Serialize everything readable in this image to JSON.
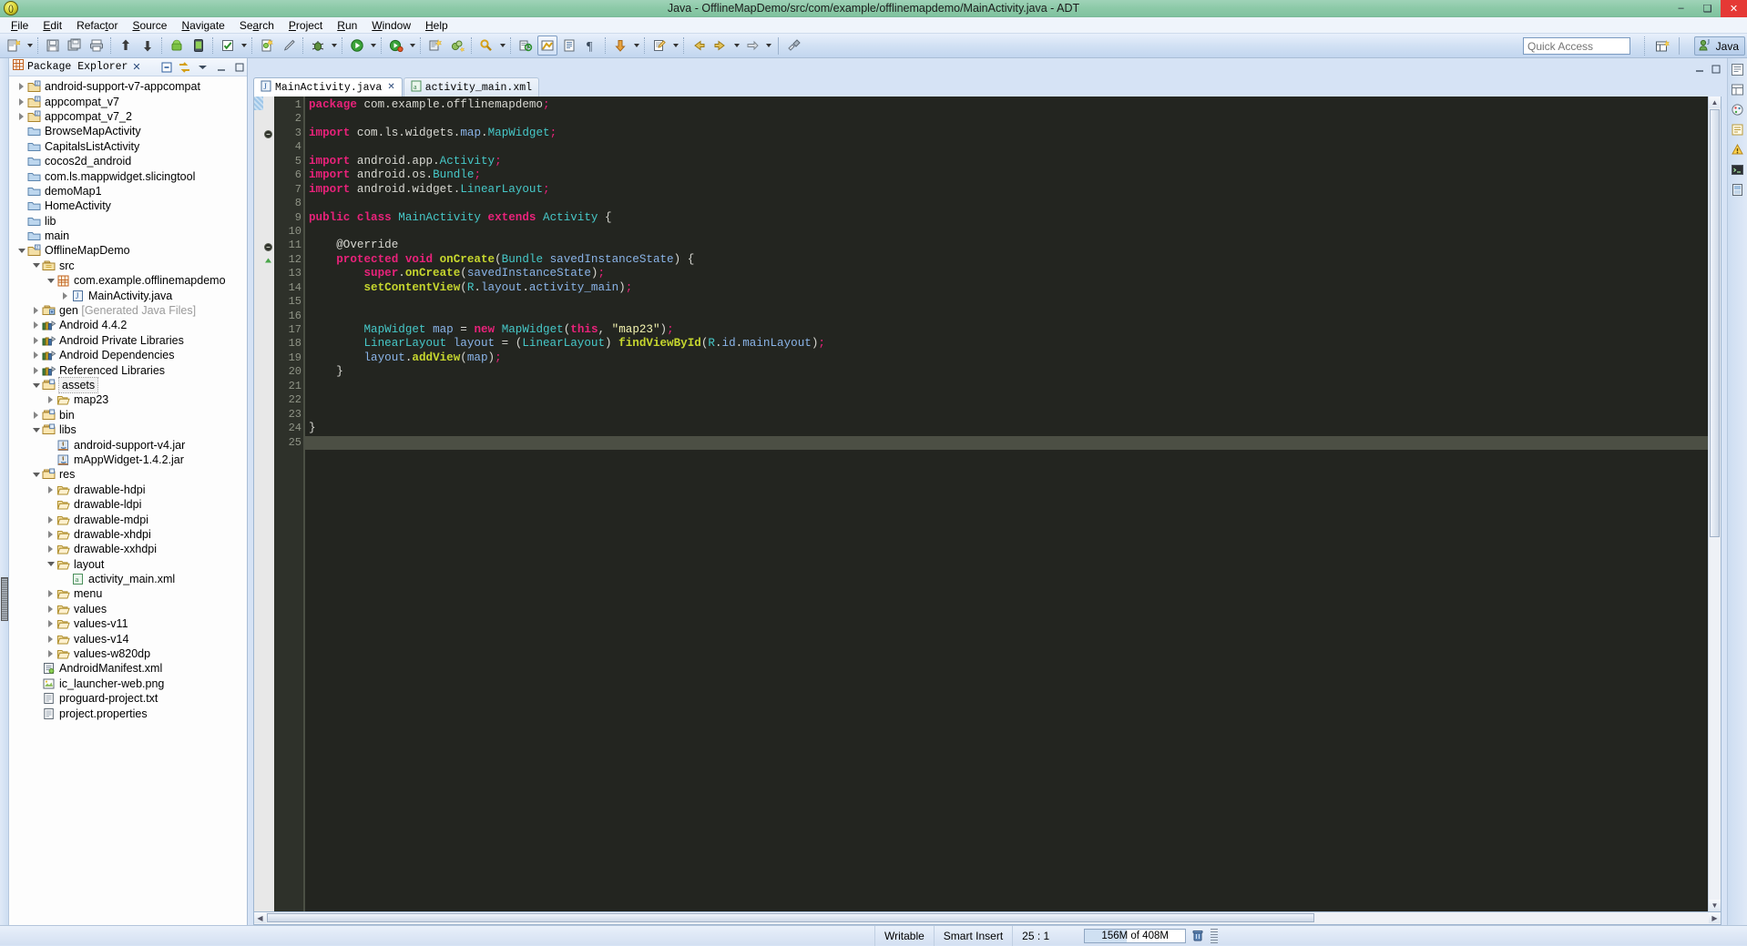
{
  "window": {
    "title": "Java - OfflineMapDemo/src/com/example/offlinemapdemo/MainActivity.java - ADT",
    "app_icon": "eclipse-icon",
    "minimize_label": "–",
    "maximize_label": "❑",
    "close_label": "✕"
  },
  "menubar": {
    "items": [
      {
        "label": "File",
        "mnemonic": "F"
      },
      {
        "label": "Edit",
        "mnemonic": "E"
      },
      {
        "label": "Refactor",
        "mnemonic": "t"
      },
      {
        "label": "Source",
        "mnemonic": "S"
      },
      {
        "label": "Navigate",
        "mnemonic": "N"
      },
      {
        "label": "Search",
        "mnemonic": "a"
      },
      {
        "label": "Project",
        "mnemonic": "P"
      },
      {
        "label": "Run",
        "mnemonic": "R"
      },
      {
        "label": "Window",
        "mnemonic": "W"
      },
      {
        "label": "Help",
        "mnemonic": "H"
      }
    ]
  },
  "toolbar": {
    "icons": [
      "new-wizard-icon",
      "save-icon",
      "save-all-icon",
      "print-icon",
      "export-icon",
      "import-icon",
      "android-sdk-manager-icon",
      "android-avd-manager-icon",
      "build-all-icon",
      "lint-icon",
      "new-android-xml-icon",
      "debug-icon",
      "run-icon",
      "external-tools-icon",
      "new-java-project-icon",
      "new-package-icon",
      "search-icon",
      "open-type-icon",
      "next-annotation-icon",
      "previous-annotation-icon",
      "last-edit-location-icon",
      "back-icon",
      "forward-icon",
      "pin-editor-icon"
    ],
    "quick_access_placeholder": "Quick Access",
    "open_perspective_icon": "open-perspective-icon",
    "perspective_label": "Java",
    "perspective_icon": "java-perspective-icon"
  },
  "explorer": {
    "title": "Package Explorer",
    "close_label": "✕",
    "buttons": [
      "collapse-all-icon",
      "link-with-editor-icon",
      "view-menu-icon",
      "minimize-icon",
      "maximize-icon"
    ],
    "tree": [
      {
        "label": "android-support-v7-appcompat",
        "indent": 0,
        "twist": "closed",
        "icon": "java-project-icon"
      },
      {
        "label": "appcompat_v7",
        "indent": 0,
        "twist": "closed",
        "icon": "java-project-icon"
      },
      {
        "label": "appcompat_v7_2",
        "indent": 0,
        "twist": "closed",
        "icon": "java-project-icon"
      },
      {
        "label": "BrowseMapActivity",
        "indent": 0,
        "twist": "none",
        "icon": "folder-closed-icon"
      },
      {
        "label": "CapitalsListActivity",
        "indent": 0,
        "twist": "none",
        "icon": "folder-closed-icon"
      },
      {
        "label": "cocos2d_android",
        "indent": 0,
        "twist": "none",
        "icon": "folder-closed-icon"
      },
      {
        "label": "com.ls.mappwidget.slicingtool",
        "indent": 0,
        "twist": "none",
        "icon": "folder-closed-icon"
      },
      {
        "label": "demoMap1",
        "indent": 0,
        "twist": "none",
        "icon": "folder-closed-icon"
      },
      {
        "label": "HomeActivity",
        "indent": 0,
        "twist": "none",
        "icon": "folder-closed-icon"
      },
      {
        "label": "lib",
        "indent": 0,
        "twist": "none",
        "icon": "folder-closed-icon"
      },
      {
        "label": "main",
        "indent": 0,
        "twist": "none",
        "icon": "folder-closed-icon"
      },
      {
        "label": "OfflineMapDemo",
        "indent": 0,
        "twist": "open",
        "icon": "java-project-icon"
      },
      {
        "label": "src",
        "indent": 1,
        "twist": "open",
        "icon": "source-folder-icon"
      },
      {
        "label": "com.example.offlinemapdemo",
        "indent": 2,
        "twist": "open",
        "icon": "package-icon"
      },
      {
        "label": "MainActivity.java",
        "indent": 3,
        "twist": "closed",
        "icon": "java-file-icon"
      },
      {
        "label": "gen ",
        "suffix": "[Generated Java Files]",
        "indent": 1,
        "twist": "closed",
        "icon": "gen-folder-icon"
      },
      {
        "label": "Android 4.4.2",
        "indent": 1,
        "twist": "closed",
        "icon": "library-icon"
      },
      {
        "label": "Android Private Libraries",
        "indent": 1,
        "twist": "closed",
        "icon": "library-icon"
      },
      {
        "label": "Android Dependencies",
        "indent": 1,
        "twist": "closed",
        "icon": "library-icon"
      },
      {
        "label": "Referenced Libraries",
        "indent": 1,
        "twist": "closed",
        "icon": "library-icon"
      },
      {
        "label": "assets",
        "indent": 1,
        "twist": "open",
        "icon": "res-folder-icon",
        "selected": true
      },
      {
        "label": "map23",
        "indent": 2,
        "twist": "closed",
        "icon": "folder-open-icon"
      },
      {
        "label": "bin",
        "indent": 1,
        "twist": "closed",
        "icon": "res-folder-icon"
      },
      {
        "label": "libs",
        "indent": 1,
        "twist": "open",
        "icon": "res-folder-icon"
      },
      {
        "label": "android-support-v4.jar",
        "indent": 2,
        "twist": "none",
        "icon": "jar-icon"
      },
      {
        "label": "mAppWidget-1.4.2.jar",
        "indent": 2,
        "twist": "none",
        "icon": "jar-icon"
      },
      {
        "label": "res",
        "indent": 1,
        "twist": "open",
        "icon": "res-folder-icon"
      },
      {
        "label": "drawable-hdpi",
        "indent": 2,
        "twist": "closed",
        "icon": "folder-open-icon"
      },
      {
        "label": "drawable-ldpi",
        "indent": 2,
        "twist": "none",
        "icon": "folder-open-icon"
      },
      {
        "label": "drawable-mdpi",
        "indent": 2,
        "twist": "closed",
        "icon": "folder-open-icon"
      },
      {
        "label": "drawable-xhdpi",
        "indent": 2,
        "twist": "closed",
        "icon": "folder-open-icon"
      },
      {
        "label": "drawable-xxhdpi",
        "indent": 2,
        "twist": "closed",
        "icon": "folder-open-icon"
      },
      {
        "label": "layout",
        "indent": 2,
        "twist": "open",
        "icon": "folder-open-icon"
      },
      {
        "label": "activity_main.xml",
        "indent": 3,
        "twist": "none",
        "icon": "xml-file-icon"
      },
      {
        "label": "menu",
        "indent": 2,
        "twist": "closed",
        "icon": "folder-open-icon"
      },
      {
        "label": "values",
        "indent": 2,
        "twist": "closed",
        "icon": "folder-open-icon"
      },
      {
        "label": "values-v11",
        "indent": 2,
        "twist": "closed",
        "icon": "folder-open-icon"
      },
      {
        "label": "values-v14",
        "indent": 2,
        "twist": "closed",
        "icon": "folder-open-icon"
      },
      {
        "label": "values-w820dp",
        "indent": 2,
        "twist": "closed",
        "icon": "folder-open-icon"
      },
      {
        "label": "AndroidManifest.xml",
        "indent": 1,
        "twist": "none",
        "icon": "manifest-icon"
      },
      {
        "label": "ic_launcher-web.png",
        "indent": 1,
        "twist": "none",
        "icon": "image-file-icon"
      },
      {
        "label": "proguard-project.txt",
        "indent": 1,
        "twist": "none",
        "icon": "text-file-icon"
      },
      {
        "label": "project.properties",
        "indent": 1,
        "twist": "none",
        "icon": "text-file-icon"
      }
    ]
  },
  "editor": {
    "tabs": [
      {
        "label": "MainActivity.java",
        "icon": "java-file-icon",
        "active": true,
        "close": "✕"
      },
      {
        "label": "activity_main.xml",
        "icon": "xml-file-icon",
        "active": false,
        "close": ""
      }
    ],
    "line_numbers": [
      "1",
      "2",
      "3",
      "4",
      "5",
      "6",
      "7",
      "8",
      "9",
      "10",
      "11",
      "12",
      "13",
      "14",
      "15",
      "16",
      "17",
      "18",
      "19",
      "20",
      "21",
      "22",
      "23",
      "24",
      "25"
    ],
    "code_lines": [
      "package com.example.offlinemapdemo;",
      "",
      "import com.ls.widgets.map.MapWidget;",
      "",
      "import android.app.Activity;",
      "import android.os.Bundle;",
      "import android.widget.LinearLayout;",
      "",
      "public class MainActivity extends Activity {",
      "",
      "    @Override",
      "    protected void onCreate(Bundle savedInstanceState) {",
      "        super.onCreate(savedInstanceState);",
      "        setContentView(R.layout.activity_main);",
      "",
      "",
      "        MapWidget map = new MapWidget(this, \"map23\");",
      "        LinearLayout layout = (LinearLayout) findViewById(R.id.mainLayout);",
      "        layout.addView(map);",
      "    }",
      "",
      "",
      "",
      "}",
      ""
    ],
    "cursor_line": 25,
    "fold_markers": [
      {
        "line": 3,
        "type": "collapse"
      },
      {
        "line": 11,
        "type": "collapse"
      }
    ],
    "scroll_up_icon": "▲",
    "scroll_down_icon": "▼",
    "scroll_left_icon": "◀",
    "scroll_right_icon": "▶"
  },
  "rightbar": {
    "icons": [
      "outline-view-icon",
      "properties-view-icon",
      "palette-icon",
      "snippets-icon",
      "lint-warnings-icon",
      "console-icon",
      "graphical-layout-icon"
    ]
  },
  "statusbar": {
    "writable": "Writable",
    "insert_mode": "Smart Insert",
    "position": "25 : 1",
    "memory": "156M of 408M",
    "trash_icon": "trash-icon"
  },
  "colors": {
    "title_bar": "#8ecaa9",
    "toolbar": "#d2e1f4",
    "editor_bg": "#232520",
    "keyword": "#e8227a",
    "type": "#46c8c8",
    "method": "#c6d62e",
    "string": "#f4f4b0",
    "field": "#8ab4e8",
    "gutter_bg": "#2e312a",
    "cursor_line": "#4c4f44"
  }
}
